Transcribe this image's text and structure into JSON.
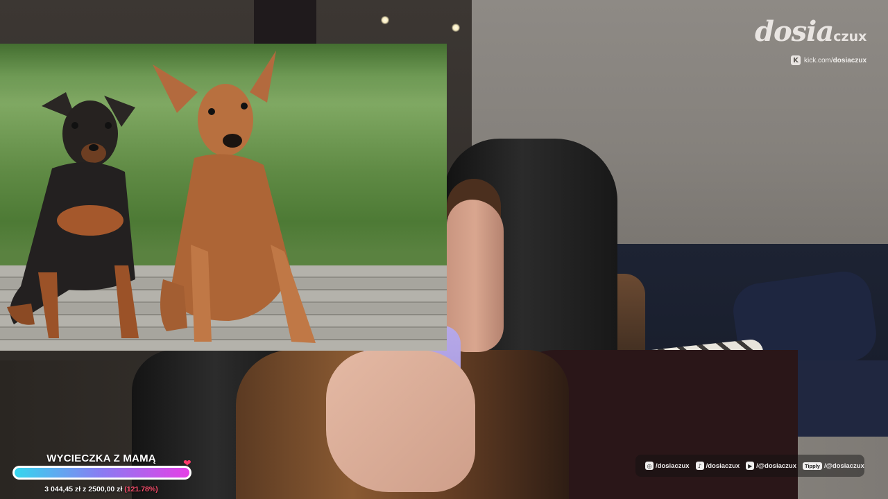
{
  "branding": {
    "logo_main": "dosia",
    "logo_small": "czux",
    "kick_icon": "kick-icon",
    "kick_prefix": "kick.com/",
    "kick_handle": "dosiaczux"
  },
  "goal": {
    "title": "WYCIECZKA Z MAMĄ",
    "heart_icon": "heart-icon",
    "progress_fraction": 1.0,
    "amount_text": "3 044,45 zł z 2500,00 zł",
    "percent_text": "(121.78%)",
    "colors": {
      "start": "#35d6ee",
      "end": "#e540e6",
      "percent": "#ff4f6e"
    }
  },
  "socials": [
    {
      "icon": "instagram-icon",
      "glyph": "◎",
      "handle": "/dosiaczux"
    },
    {
      "icon": "tiktok-icon",
      "glyph": "♪",
      "handle": "/dosiaczux"
    },
    {
      "icon": "youtube-icon",
      "glyph": "▶",
      "handle": "/@dosiaczux"
    },
    {
      "icon": "tipply-icon",
      "tag": "Tipply",
      "handle": "/@dosiaczux"
    }
  ],
  "media": {
    "subject": "dogs-image"
  }
}
